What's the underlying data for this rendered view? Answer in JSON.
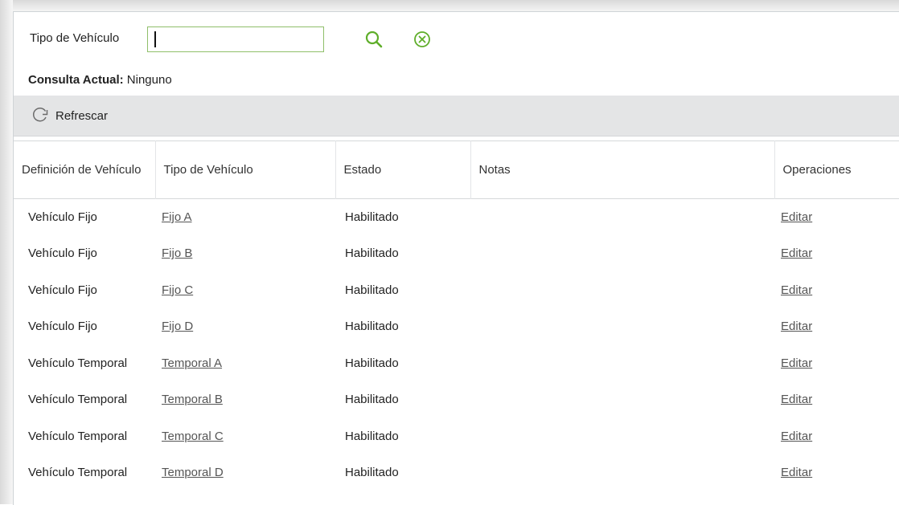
{
  "search": {
    "label": "Tipo de Vehículo",
    "value": "",
    "placeholder": ""
  },
  "icons": {
    "search": "search-icon",
    "clear": "clear-icon",
    "refresh": "refresh-icon"
  },
  "query": {
    "label": "Consulta Actual:",
    "value": "Ninguno"
  },
  "toolbar": {
    "refresh_label": "Refrescar"
  },
  "table": {
    "columns": [
      "Definición de Vehículo",
      "Tipo de Vehículo",
      "Estado",
      "Notas",
      "Operaciones"
    ],
    "rows": [
      {
        "definition": "Vehículo Fijo",
        "type": "Fijo A",
        "state": "Habilitado",
        "notes": "",
        "op": "Editar"
      },
      {
        "definition": "Vehículo Fijo",
        "type": "Fijo B",
        "state": "Habilitado",
        "notes": "",
        "op": "Editar"
      },
      {
        "definition": "Vehículo Fijo",
        "type": "Fijo C",
        "state": "Habilitado",
        "notes": "",
        "op": "Editar"
      },
      {
        "definition": "Vehículo Fijo",
        "type": "Fijo D",
        "state": "Habilitado",
        "notes": "",
        "op": "Editar"
      },
      {
        "definition": "Vehículo Temporal",
        "type": "Temporal A",
        "state": "Habilitado",
        "notes": "",
        "op": "Editar"
      },
      {
        "definition": "Vehículo Temporal",
        "type": "Temporal B",
        "state": "Habilitado",
        "notes": "",
        "op": "Editar"
      },
      {
        "definition": "Vehículo Temporal",
        "type": "Temporal C",
        "state": "Habilitado",
        "notes": "",
        "op": "Editar"
      },
      {
        "definition": "Vehículo Temporal",
        "type": "Temporal D",
        "state": "Habilitado",
        "notes": "",
        "op": "Editar"
      }
    ]
  },
  "colors": {
    "accent_green": "#5fae2a",
    "input_border": "#8fbf6a",
    "toolbar_bg": "#e4e5e6"
  }
}
